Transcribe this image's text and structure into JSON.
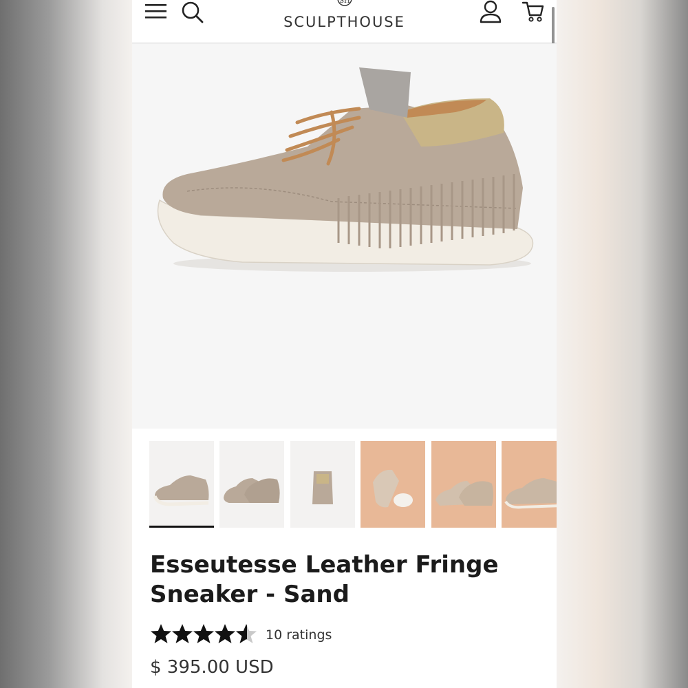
{
  "brand": {
    "name": "SCULPTHOUSE",
    "logo_monogram": "SH"
  },
  "header": {
    "icons": [
      "menu-icon",
      "search-icon",
      "account-icon",
      "cart-icon"
    ]
  },
  "gallery": {
    "thumbnail_count": 6,
    "active_index": 0
  },
  "product": {
    "title": "Esseutesse Leather Fringe Sneaker - Sand",
    "rating": 4.7,
    "rating_max": 5,
    "ratings_text": "10 ratings",
    "price": "$ 395.00 USD"
  },
  "colors": {
    "shoe": "#b9a999",
    "sole": "#f2ede4",
    "laces": "#c18a55",
    "gold": "#c9b587",
    "peach_bg": "#e8b897"
  }
}
